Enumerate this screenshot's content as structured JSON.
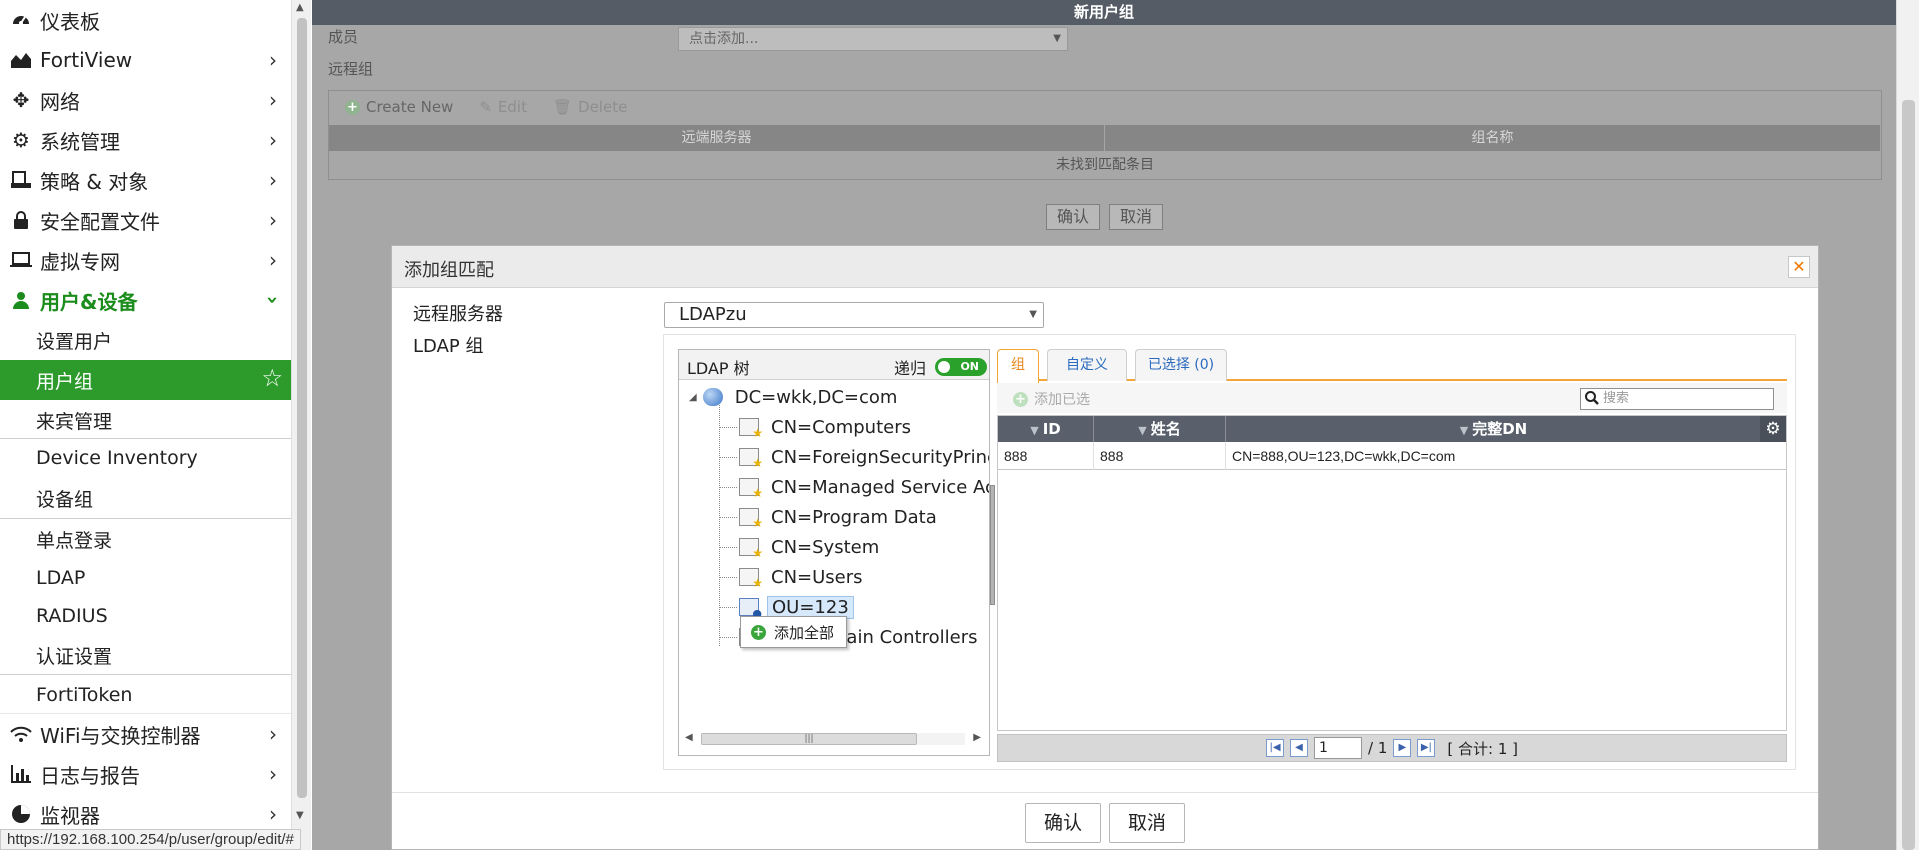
{
  "sidebar": {
    "items": [
      {
        "label": "仪表板",
        "icon": "dashboard-icon"
      },
      {
        "label": "FortiView",
        "icon": "chart-icon"
      },
      {
        "label": "网络",
        "icon": "network-arrows-icon"
      },
      {
        "label": "系统管理",
        "icon": "gear-icon"
      },
      {
        "label": "策略 & 对象",
        "icon": "policy-icon"
      },
      {
        "label": "安全配置文件",
        "icon": "lock-icon"
      },
      {
        "label": "虚拟专网",
        "icon": "laptop-icon"
      },
      {
        "label": "用户&设备",
        "icon": "user-icon"
      },
      {
        "label": "WiFi与交换控制器",
        "icon": "wifi-icon"
      },
      {
        "label": "日志与报告",
        "icon": "bar-chart-icon"
      },
      {
        "label": "监视器",
        "icon": "pie-chart-icon"
      }
    ],
    "subitems": [
      "设置用户",
      "用户组",
      "来宾管理",
      "Device Inventory",
      "设备组",
      "单点登录",
      "LDAP",
      "RADIUS",
      "认证设置",
      "FortiToken"
    ]
  },
  "status_url": "https://192.168.100.254/p/user/group/edit/#",
  "background": {
    "title": "新用户组",
    "members_label": "成员",
    "members_placeholder": "点击添加...",
    "remote_groups_label": "远程组",
    "toolbar": {
      "create": "Create New",
      "edit": "Edit",
      "delete": "Delete"
    },
    "columns": [
      "远端服务器",
      "组名称"
    ],
    "empty_text": "未找到匹配条目",
    "ok": "确认",
    "cancel": "取消"
  },
  "modal": {
    "title": "添加组匹配",
    "remote_server_label": "远程服务器",
    "remote_server_value": "LDAPzu",
    "ldap_group_label": "LDAP 组",
    "tree": {
      "title": "LDAP 树",
      "recursive_label": "递归",
      "recursive_state": "ON",
      "root": "DC=wkk,DC=com",
      "nodes": [
        "CN=Computers",
        "CN=ForeignSecurityPrinc",
        "CN=Managed Service Acc",
        "CN=Program Data",
        "CN=System",
        "CN=Users",
        "OU=123",
        "nain Controllers"
      ],
      "context_menu": "添加全部"
    },
    "tabs": [
      "组",
      "自定义",
      "已选择 (0)"
    ],
    "add_selected": "添加已选",
    "search_placeholder": "搜索",
    "grid": {
      "columns": [
        "ID",
        "姓名",
        "完整DN"
      ],
      "rows": [
        {
          "id": "888",
          "name": "888",
          "dn": "CN=888,OU=123,DC=wkk,DC=com"
        }
      ]
    },
    "pager": {
      "page": "1",
      "total_pages": "/ 1",
      "total": "[ 合计: 1 ]"
    },
    "ok": "确认",
    "cancel": "取消"
  },
  "colors": {
    "accent_green": "#2c9b2c",
    "tab_orange": "#f3a53a",
    "grid_header": "#59606b"
  }
}
